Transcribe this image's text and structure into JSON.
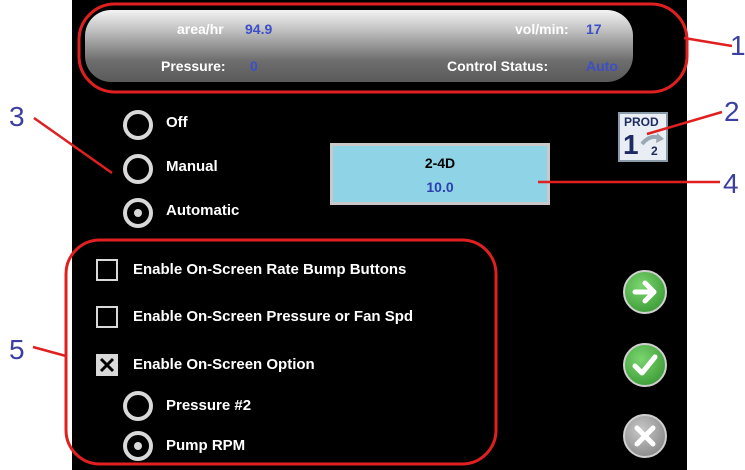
{
  "status": {
    "area_label": "area/hr",
    "area_value": "94.9",
    "vol_label": "vol/min:",
    "vol_value": "17",
    "pressure_label": "Pressure:",
    "pressure_value": "0",
    "control_label": "Control Status:",
    "control_value": "Auto"
  },
  "modes": [
    {
      "label": "Off",
      "selected": false
    },
    {
      "label": "Manual",
      "selected": false
    },
    {
      "label": "Automatic",
      "selected": true
    }
  ],
  "product": {
    "name": "2-4D",
    "rate": "10.0"
  },
  "prod_icon": {
    "label": "PROD",
    "primary": "1",
    "secondary": "2"
  },
  "options": [
    {
      "label": "Enable On-Screen Rate Bump Buttons",
      "checked": false
    },
    {
      "label": "Enable On-Screen Pressure or Fan Spd",
      "checked": false
    },
    {
      "label": "Enable On-Screen Option",
      "checked": true
    }
  ],
  "option_choices": [
    {
      "label": "Pressure #2",
      "selected": false
    },
    {
      "label": "Pump RPM",
      "selected": true
    }
  ],
  "buttons": {
    "next": "arrow-right-icon",
    "accept": "check-icon",
    "cancel": "x-icon"
  },
  "callouts": [
    "1",
    "2",
    "3",
    "4",
    "5"
  ],
  "colors": {
    "value_blue": "#3b4fc8",
    "callout_red": "#e02020",
    "callout_text": "#3b3fa0",
    "green": "#3fa53a",
    "product_box": "#8fd3e6"
  }
}
